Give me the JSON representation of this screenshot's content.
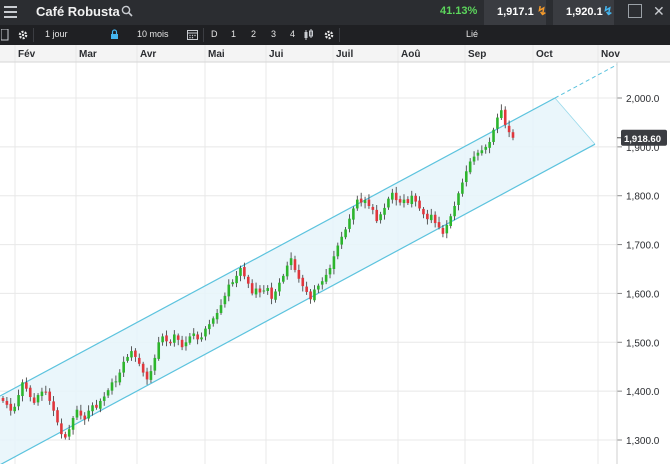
{
  "header": {
    "instrument": "Café Robusta",
    "change_pct": "41.13%",
    "sell_price": "1,917.1",
    "buy_price": "1,920.1"
  },
  "toolbar": {
    "interval": "1 jour",
    "range": "10 mois",
    "period_d": "D",
    "period_1": "1",
    "period_2": "2",
    "period_3": "3",
    "period_4": "4",
    "linked": "Lié"
  },
  "chart_data": {
    "type": "candlestick",
    "x_labels": [
      "Fév",
      "Mar",
      "Avr",
      "Mai",
      "Jui",
      "Juil",
      "Aoû",
      "Sep",
      "Oct",
      "Nov"
    ],
    "y_ticks": [
      "2,000.0",
      "1,900.0",
      "1,800.0",
      "1,700.0",
      "1,600.0",
      "1,500.0",
      "1,400.0",
      "1,300.0"
    ],
    "ylim": [
      1290,
      2010
    ],
    "current_price_label": "1,918.60",
    "current_price": 1918.6,
    "grid": true,
    "colors": {
      "up": "#2db52d",
      "down": "#e0363c",
      "channel": "#5cc3de",
      "channel_fill": "#e6f5fa",
      "price_tag": "#3b3d42"
    },
    "channel": {
      "upper": [
        [
          0,
          1390
        ],
        [
          555,
          2000
        ]
      ],
      "lower": [
        [
          37,
          1290
        ],
        [
          590,
          1900
        ]
      ]
    },
    "closes": [
      1380,
      1372,
      1360,
      1368,
      1392,
      1418,
      1405,
      1388,
      1376,
      1392,
      1399,
      1397,
      1380,
      1360,
      1336,
      1312,
      1305,
      1322,
      1345,
      1362,
      1350,
      1342,
      1360,
      1371,
      1366,
      1380,
      1389,
      1402,
      1418,
      1420,
      1438,
      1460,
      1470,
      1482,
      1470,
      1456,
      1438,
      1424,
      1441,
      1468,
      1500,
      1512,
      1502,
      1498,
      1516,
      1505,
      1490,
      1500,
      1512,
      1518,
      1506,
      1510,
      1528,
      1537,
      1549,
      1560,
      1576,
      1595,
      1618,
      1623,
      1636,
      1652,
      1635,
      1620,
      1600,
      1610,
      1602,
      1606,
      1611,
      1589,
      1604,
      1622,
      1636,
      1657,
      1672,
      1648,
      1630,
      1615,
      1603,
      1588,
      1608,
      1616,
      1625,
      1638,
      1652,
      1676,
      1698,
      1716,
      1731,
      1753,
      1774,
      1792,
      1786,
      1791,
      1779,
      1771,
      1748,
      1762,
      1775,
      1794,
      1806,
      1791,
      1786,
      1792,
      1785,
      1800,
      1788,
      1774,
      1762,
      1752,
      1761,
      1744,
      1735,
      1722,
      1740,
      1758,
      1779,
      1805,
      1827,
      1850,
      1870,
      1880,
      1888,
      1893,
      1900,
      1910,
      1935,
      1960,
      1975,
      1945,
      1930,
      1918.6
    ]
  }
}
